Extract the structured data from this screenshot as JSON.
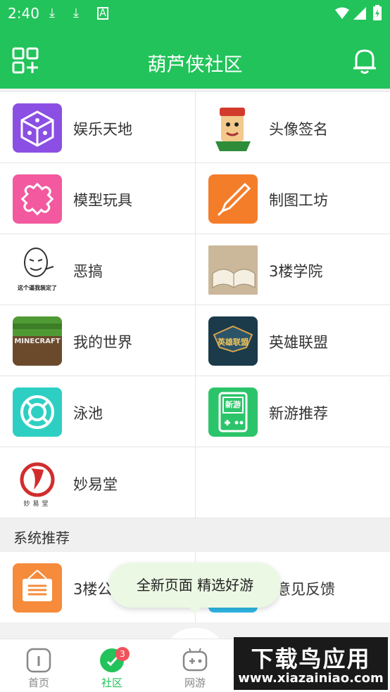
{
  "status_bar": {
    "time": "2:40"
  },
  "header": {
    "title": "葫芦侠社区"
  },
  "categories": [
    {
      "label": "娱乐天地",
      "icon": "dice-icon",
      "color": "#8b4fe3"
    },
    {
      "label": "头像签名",
      "icon": "cartoon-avatar-icon",
      "color": "#f1e3c5"
    },
    {
      "label": "模型玩具",
      "icon": "puzzle-icon",
      "color": "#f2599e"
    },
    {
      "label": "制图工坊",
      "icon": "pen-nib-icon",
      "color": "#f47d2a"
    },
    {
      "label": "恶搞",
      "icon": "meme-face-icon",
      "caption": "这个逼我装定了",
      "color": "#ffffff"
    },
    {
      "label": "3楼学院",
      "icon": "open-book-icon",
      "color": "#d9c7a6"
    },
    {
      "label": "我的世界",
      "icon": "minecraft-icon",
      "caption": "MINECRAFT",
      "color": "#6b4a2b"
    },
    {
      "label": "英雄联盟",
      "icon": "lol-icon",
      "caption": "英雄联盟",
      "color": "#1b3a4a"
    },
    {
      "label": "泳池",
      "icon": "lifebuoy-icon",
      "color": "#2ecfc3"
    },
    {
      "label": "新游推荐",
      "icon": "gameboy-icon",
      "caption": "新游",
      "color": "#2cc46a"
    },
    {
      "label": "妙易堂",
      "icon": "miaoyitang-logo-icon",
      "caption": "妙易堂",
      "color": "#d12d2d"
    }
  ],
  "system_section": {
    "title": "系统推荐",
    "items": [
      {
        "label": "3楼公",
        "icon": "signboard-icon",
        "color": "#f58b3b"
      },
      {
        "label": "意见反馈",
        "icon": "feedback-icon",
        "color": "#2fb8e8"
      }
    ]
  },
  "toast": {
    "text": "全新页面  精选好游"
  },
  "bottom_nav": {
    "items": [
      {
        "label": "首页",
        "icon": "home-icon"
      },
      {
        "label": "社区",
        "icon": "community-icon",
        "badge": "3",
        "active": true
      },
      {
        "label": "网游",
        "icon": "gamepad-icon"
      }
    ]
  },
  "watermark": {
    "title": "下载鸟应用",
    "url": "www.xiazainiao.com"
  },
  "colors": {
    "brand_green": "#22c35a",
    "badge_red": "#f0535b"
  }
}
